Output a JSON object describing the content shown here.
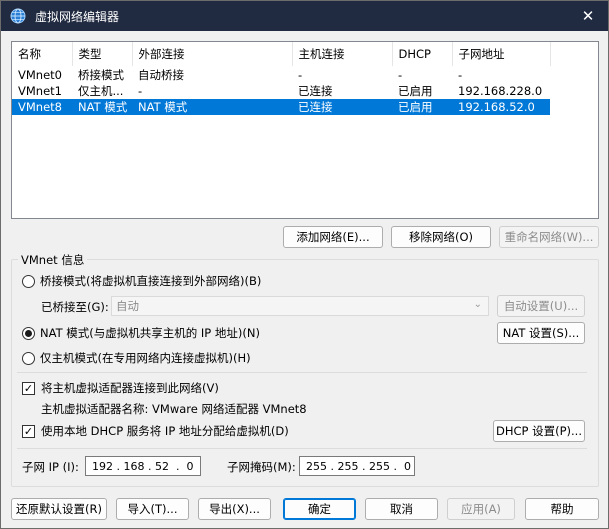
{
  "window": {
    "title": "虚拟网络编辑器",
    "close_glyph": "✕"
  },
  "table": {
    "columns": [
      "名称",
      "类型",
      "外部连接",
      "主机连接",
      "DHCP",
      "子网地址"
    ],
    "rows": [
      [
        "VMnet0",
        "桥接模式",
        "自动桥接",
        "-",
        "-",
        "-"
      ],
      [
        "VMnet1",
        "仅主机...",
        "-",
        "已连接",
        "已启用",
        "192.168.228.0"
      ],
      [
        "VMnet8",
        "NAT 模式",
        "NAT 模式",
        "已连接",
        "已启用",
        "192.168.52.0"
      ]
    ],
    "selected_row": 2
  },
  "list_buttons": {
    "add": "添加网络(E)...",
    "remove": "移除网络(O)",
    "rename": "重命名网络(W)..."
  },
  "vmnet_info": {
    "group_label": "VMnet 信息",
    "bridge_mode": "桥接模式(将虚拟机直接连接到外部网络)(B)",
    "bridged_to_label": "已桥接至(G):",
    "bridged_to_value": "自动",
    "auto_settings": "自动设置(U)...",
    "nat_mode": "NAT 模式(与虚拟机共享主机的 IP 地址)(N)",
    "nat_settings": "NAT 设置(S)...",
    "host_only": "仅主机模式(在专用网络内连接虚拟机)(H)",
    "selected_mode": "nat",
    "connect_adapter": "将主机虚拟适配器连接到此网络(V)",
    "adapter_name_label": "主机虚拟适配器名称: VMware 网络适配器 VMnet8",
    "use_dhcp": "使用本地 DHCP 服务将 IP 地址分配给虚拟机(D)",
    "dhcp_settings": "DHCP 设置(P)...",
    "subnet_ip_label": "子网 IP (I):",
    "subnet_ip": "192 . 168 . 52  .  0",
    "subnet_mask_label": "子网掩码(M):",
    "subnet_mask": "255 . 255 . 255 .  0"
  },
  "footer_buttons": {
    "restore": "还原默认设置(R)",
    "import": "导入(T)...",
    "export": "导出(X)...",
    "ok": "确定",
    "cancel": "取消",
    "apply": "应用(A)",
    "help": "帮助"
  },
  "colors": {
    "titlebar": "#202a40",
    "selection": "#0078d7",
    "accent": "#0078d7"
  }
}
